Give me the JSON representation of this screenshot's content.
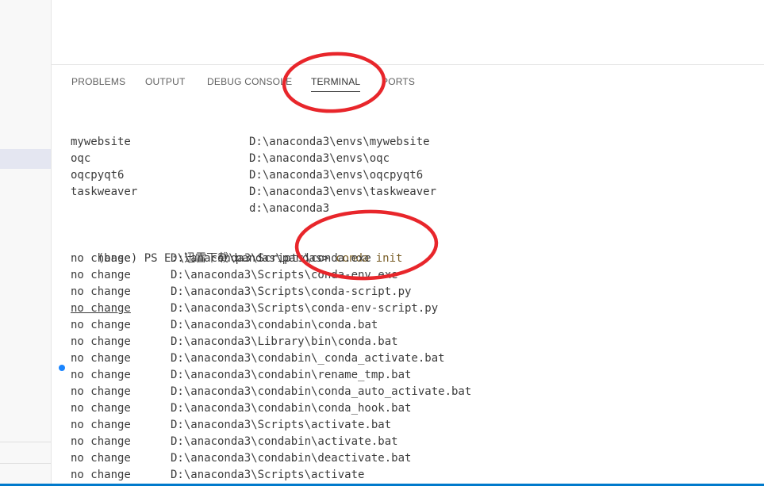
{
  "panel": {
    "tabs": [
      {
        "label": "PROBLEMS"
      },
      {
        "label": "OUTPUT"
      },
      {
        "label": "DEBUG CONSOLE"
      },
      {
        "label": "TERMINAL",
        "active": true
      },
      {
        "label": "PORTS"
      }
    ]
  },
  "terminal": {
    "env_list": [
      {
        "name": "mywebsite",
        "path": "D:\\anaconda3\\envs\\mywebsite"
      },
      {
        "name": "oqc",
        "path": "D:\\anaconda3\\envs\\oqc"
      },
      {
        "name": "oqcpyqt6",
        "path": "D:\\anaconda3\\envs\\oqcpyqt6"
      },
      {
        "name": "taskweaver",
        "path": "D:\\anaconda3\\envs\\taskweaver"
      },
      {
        "name": "",
        "path": "d:\\anaconda3"
      }
    ],
    "prompt": "(base) PS E:\\迅雷下载\\pandas\\pandas>",
    "command": "conda init",
    "results": [
      {
        "status": "no change",
        "path": "D:\\anaconda3\\Scripts\\conda.exe"
      },
      {
        "status": "no change",
        "path": "D:\\anaconda3\\Scripts\\conda-env.exe"
      },
      {
        "status": "no change",
        "path": "D:\\anaconda3\\Scripts\\conda-script.py"
      },
      {
        "status": "no change",
        "path": "D:\\anaconda3\\Scripts\\conda-env-script.py"
      },
      {
        "status": "no change",
        "path": "D:\\anaconda3\\condabin\\conda.bat"
      },
      {
        "status": "no change",
        "path": "D:\\anaconda3\\Library\\bin\\conda.bat"
      },
      {
        "status": "no change",
        "path": "D:\\anaconda3\\condabin\\_conda_activate.bat"
      },
      {
        "status": "no change",
        "path": "D:\\anaconda3\\condabin\\rename_tmp.bat"
      },
      {
        "status": "no change",
        "path": "D:\\anaconda3\\condabin\\conda_auto_activate.bat"
      },
      {
        "status": "no change",
        "path": "D:\\anaconda3\\condabin\\conda_hook.bat"
      },
      {
        "status": "no change",
        "path": "D:\\anaconda3\\Scripts\\activate.bat"
      },
      {
        "status": "no change",
        "path": "D:\\anaconda3\\condabin\\activate.bat"
      },
      {
        "status": "no change",
        "path": "D:\\anaconda3\\condabin\\deactivate.bat"
      },
      {
        "status": "no change",
        "path": "D:\\anaconda3\\Scripts\\activate"
      }
    ]
  },
  "colors": {
    "annotation_circle": "#e8262b",
    "prompt_dot": "#1a85ff",
    "command": "#795e26",
    "status_bar": "#007acc"
  }
}
